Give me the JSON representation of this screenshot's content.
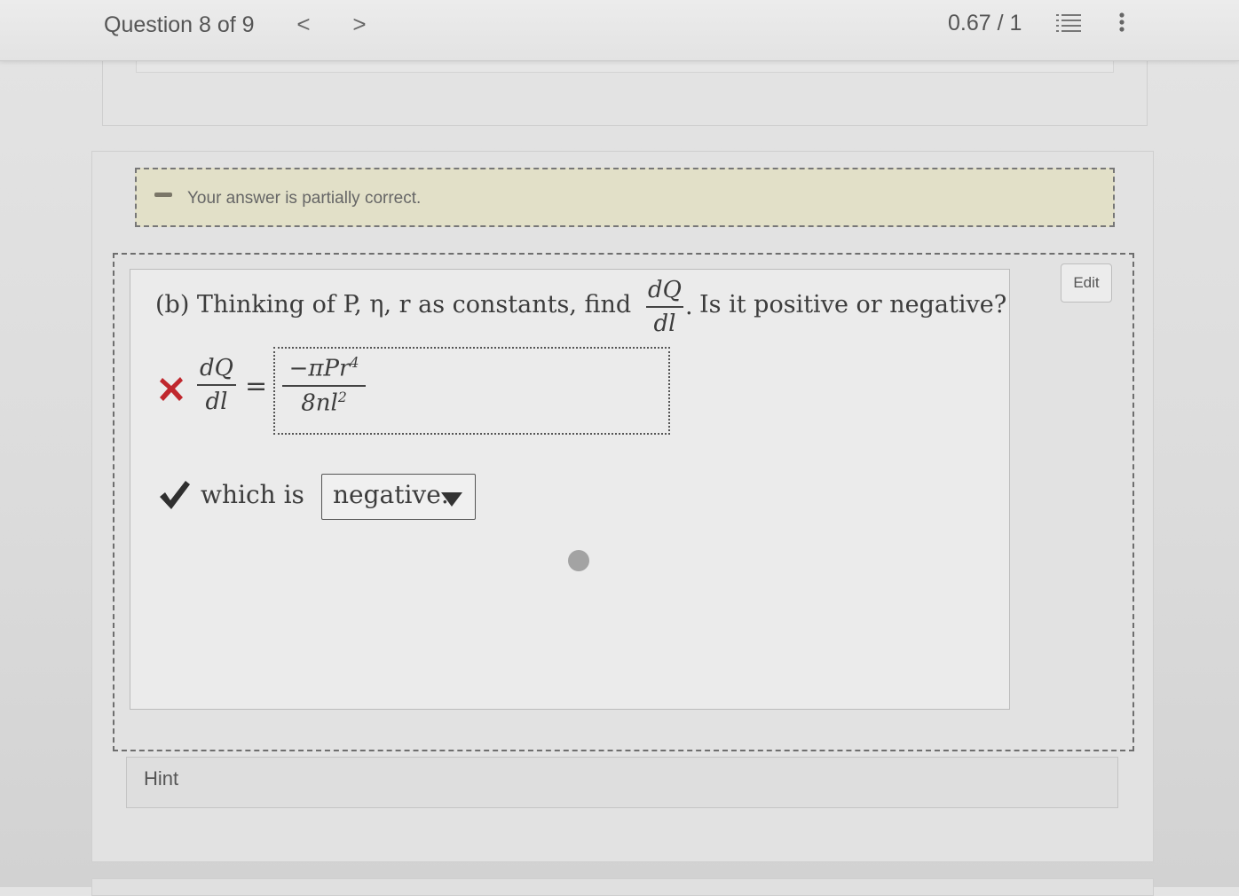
{
  "header": {
    "question_label": "Question 8 of 9",
    "prev_glyph": "<",
    "next_glyph": ">",
    "score": "0.67 / 1",
    "icons": [
      "list-icon",
      "more-vertical-icon"
    ]
  },
  "feedback": {
    "text": "Your answer is partially correct.",
    "status": "partial",
    "color": "#e2e0c8"
  },
  "question": {
    "edit_label": "Edit",
    "prompt_prefix": "(b) Thinking of P, η, r as constants, find",
    "prompt_fraction": {
      "numerator": "dQ",
      "denominator": "dl"
    },
    "prompt_period": ".",
    "prompt_suffix": "Is it positive or negative?",
    "answer_lhs": {
      "numerator": "dQ",
      "denominator": "dl"
    },
    "equals": "=",
    "answer": {
      "numerator_text": "−πPr",
      "numerator_exp": "4",
      "denominator_text": "8nl",
      "denominator_exp": "2",
      "status": "incorrect",
      "status_color": "#c0272d"
    },
    "sign_label": "which is",
    "sign_selected": "negative.",
    "sign_status": "correct",
    "sign_status_color": "#2f2f2f"
  },
  "hint": {
    "label": "Hint"
  }
}
